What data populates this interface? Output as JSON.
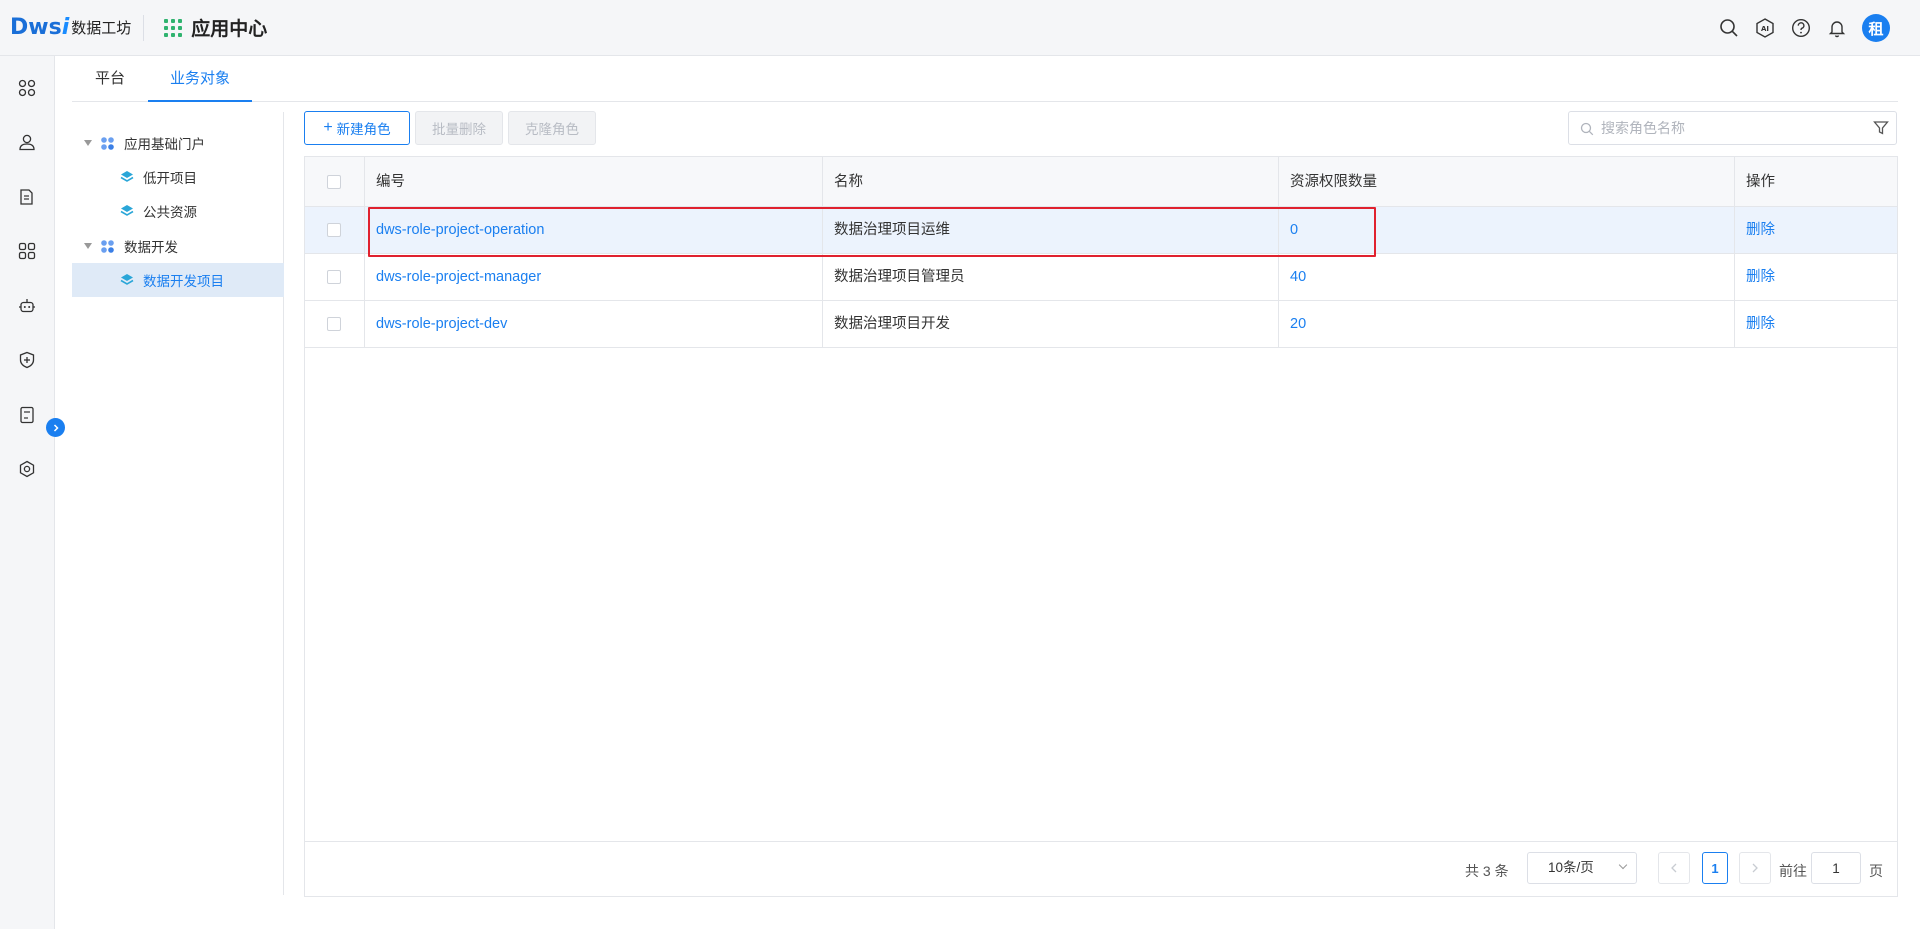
{
  "header": {
    "logo_mark": "Dws",
    "logo_i": "i",
    "logo_text": "数据工坊",
    "app_center": "应用中心",
    "avatar_text": "租",
    "icons": [
      "search-icon",
      "ai-icon",
      "help-icon",
      "bell-icon"
    ]
  },
  "rail": {
    "icons": [
      "apps-icon",
      "user-icon",
      "document-icon",
      "modules-icon",
      "robot-icon",
      "shield-icon",
      "report-icon",
      "settings-icon"
    ]
  },
  "tabs": [
    {
      "label": "平台"
    },
    {
      "label": "业务对象"
    }
  ],
  "tree": {
    "nodes": [
      {
        "label": "应用基础门户",
        "level": 0,
        "expanded": true
      },
      {
        "label": "低开项目",
        "level": 1
      },
      {
        "label": "公共资源",
        "level": 1
      },
      {
        "label": "数据开发",
        "level": 0,
        "expanded": true
      },
      {
        "label": "数据开发项目",
        "level": 1,
        "selected": true
      }
    ]
  },
  "toolbar": {
    "new_role": "新建角色",
    "batch_delete": "批量删除",
    "clone_role": "克隆角色",
    "search_placeholder": "搜索角色名称"
  },
  "table": {
    "columns": [
      "编号",
      "名称",
      "资源权限数量",
      "操作"
    ],
    "rows": [
      {
        "code": "dws-role-project-operation",
        "name": "数据治理项目运维",
        "count": "0",
        "action": "删除",
        "highlighted": true
      },
      {
        "code": "dws-role-project-manager",
        "name": "数据治理项目管理员",
        "count": "40",
        "action": "删除"
      },
      {
        "code": "dws-role-project-dev",
        "name": "数据治理项目开发",
        "count": "20",
        "action": "删除"
      }
    ]
  },
  "pagination": {
    "total": "共 3 条",
    "page_size": "10条/页",
    "current_page": "1",
    "goto_label": "前往",
    "goto_value": "1",
    "page_suffix": "页"
  },
  "colors": {
    "accent": "#1a7ff0",
    "highlight_row": "#ecf3fd",
    "annotation_box": "#e0212e"
  }
}
